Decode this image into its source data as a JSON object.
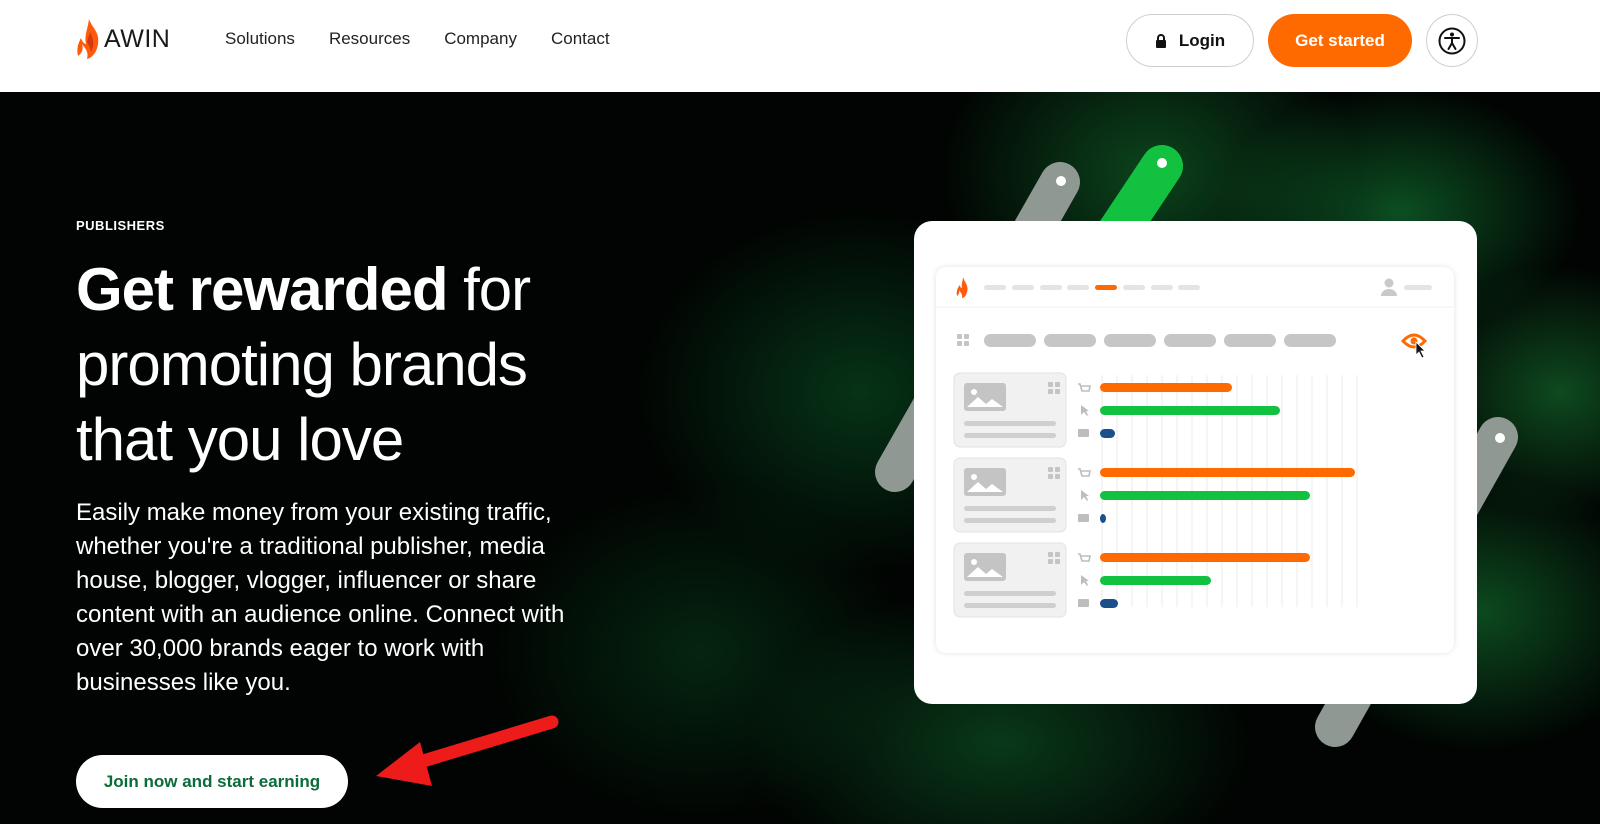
{
  "header": {
    "logo_text": "AWIN",
    "nav": [
      "Solutions",
      "Resources",
      "Company",
      "Contact"
    ],
    "login_label": "Login",
    "get_started_label": "Get started",
    "accessibility_icon": "accessibility-icon"
  },
  "hero": {
    "eyebrow": "PUBLISHERS",
    "headline_bold": "Get rewarded",
    "headline_rest_1": " for",
    "headline_line2": "promoting brands",
    "headline_line3": "that you love",
    "description": "Easily make money from your existing traffic, whether you're a traditional publisher, media house, blogger, vlogger, influencer or share content with an audience online. Connect with over 30,000 brands eager to work with businesses like you.",
    "cta_label": "Join now and start earning"
  },
  "illustration": {
    "bars": [
      {
        "orange": 0.44,
        "green": 0.6,
        "blue": 0.05
      },
      {
        "orange": 0.85,
        "green": 0.7,
        "blue": 0.02
      },
      {
        "orange": 0.7,
        "green": 0.37,
        "blue": 0.06
      }
    ]
  },
  "colors": {
    "brand_orange": "#ff6a00",
    "green_accent": "#12c140",
    "cta_text_green": "#0b6b3a",
    "bar_blue": "#1b4f8a"
  }
}
